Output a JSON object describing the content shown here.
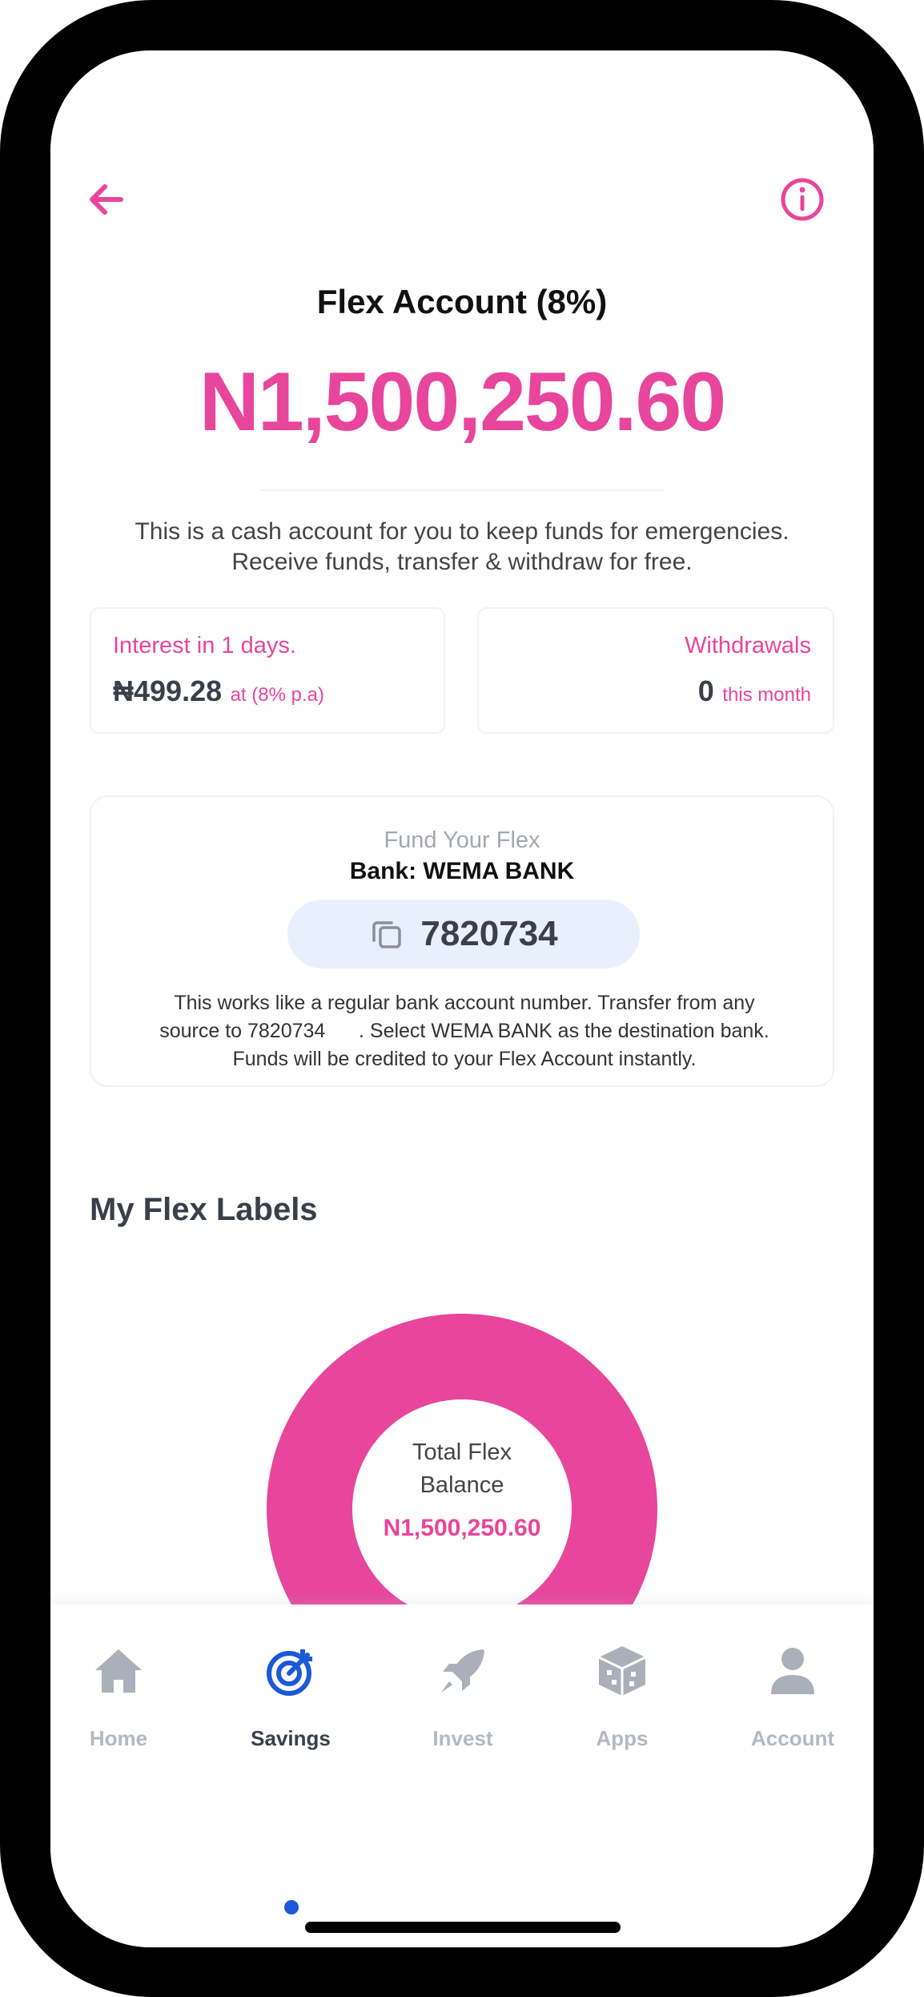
{
  "header": {
    "back_icon": "arrow-left-icon",
    "info_icon": "info-circle-icon"
  },
  "account": {
    "title": "Flex Account (8%)",
    "balance": "N1,500,250.60",
    "description_line1": "This is a cash account for you to keep funds for emergencies.",
    "description_line2": "Receive funds, transfer & withdraw for free."
  },
  "interest": {
    "label": "Interest in 1 days.",
    "amount": "₦499.28",
    "rate_note": "at (8% p.a)"
  },
  "withdrawals": {
    "label": "Withdrawals",
    "count": "0",
    "period": "this month"
  },
  "fund": {
    "title": "Fund Your Flex",
    "bank_line": "Bank: WEMA BANK",
    "account_number": "7820734",
    "copy_icon": "copy-icon",
    "note_line1": "This works like a regular bank account number. Transfer from any",
    "note_line2": "source to 7820734      . Select WEMA BANK as the destination bank.",
    "note_line3": "Funds will be credited to your Flex Account instantly."
  },
  "labels_section": {
    "title": "My Flex Labels",
    "chart_center_line1": "Total Flex",
    "chart_center_line2": "Balance",
    "chart_center_value": "N1,500,250.60"
  },
  "chart_data": {
    "type": "pie",
    "categories": [],
    "values": [
      1500250.6
    ],
    "colors": [
      "#e8459c"
    ]
  },
  "tabs": [
    {
      "label": "Home",
      "icon": "home-icon",
      "active": false
    },
    {
      "label": "Savings",
      "icon": "target-icon",
      "active": true
    },
    {
      "label": "Invest",
      "icon": "rocket-icon",
      "active": false
    },
    {
      "label": "Apps",
      "icon": "cube-icon",
      "active": false
    },
    {
      "label": "Account",
      "icon": "user-icon",
      "active": false
    }
  ],
  "colors": {
    "accent": "#e8459c",
    "active_tab": "#1a5ad8",
    "inactive_tab": "#b3b8c2"
  }
}
